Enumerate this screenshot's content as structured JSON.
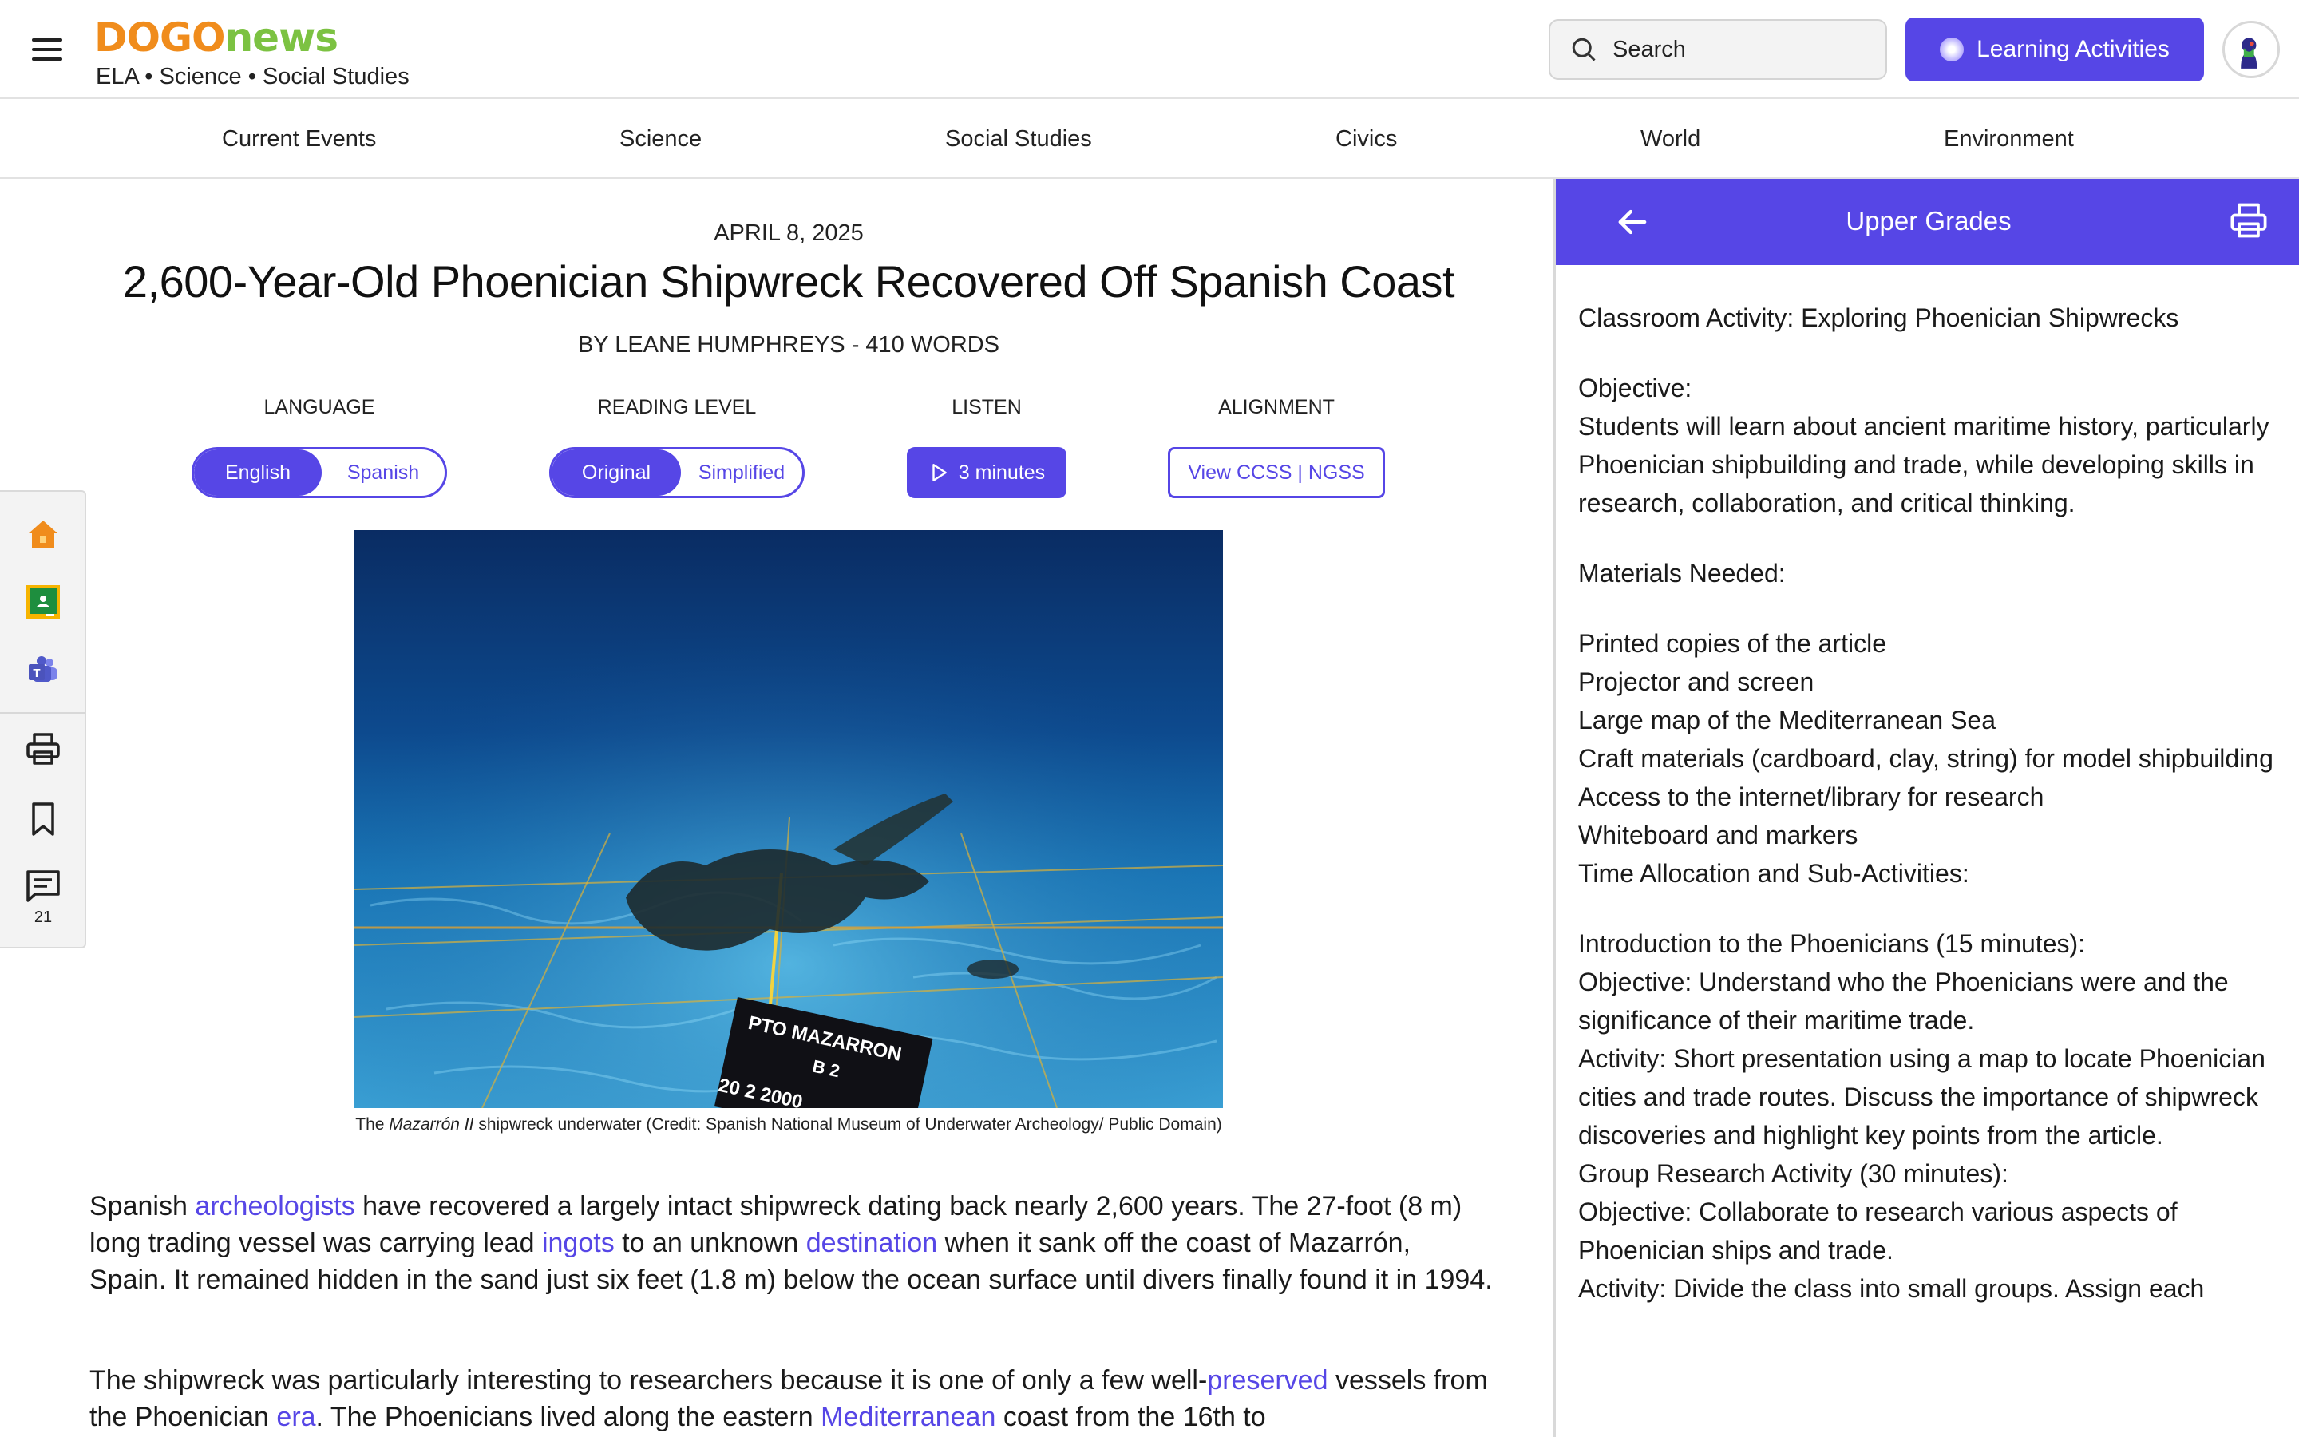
{
  "header": {
    "logo_part1": "DOGO",
    "logo_part2": "news",
    "tagline": "ELA • Science • Social Studies",
    "search_placeholder": "Search",
    "learning_activities_label": "Learning Activities",
    "brand_purple": "#5646e6",
    "logo_orange": "#f08c1c",
    "logo_green": "#7cc242"
  },
  "nav": {
    "items": [
      "Current Events",
      "Science",
      "Social Studies",
      "Civics",
      "World",
      "Environment"
    ]
  },
  "article": {
    "date": "APRIL 8, 2025",
    "title": "2,600-Year-Old Phoenician Shipwreck Recovered Off Spanish Coast",
    "byline": "BY LEANE HUMPHREYS - 410 WORDS",
    "controls": {
      "language_label": "LANGUAGE",
      "language_options": [
        "English",
        "Spanish"
      ],
      "language_selected": "English",
      "reading_label": "READING LEVEL",
      "reading_options": [
        "Original",
        "Simplified"
      ],
      "reading_selected": "Original",
      "listen_label": "LISTEN",
      "listen_button": "3 minutes",
      "alignment_label": "ALIGNMENT",
      "alignment_button": "View CCSS | NGSS"
    },
    "image": {
      "sign_line1": "PTO MAZARRON",
      "sign_line2": "B 2",
      "sign_line3": "20 2 2000"
    },
    "caption_prefix": "The ",
    "caption_ship": "Mazarrón II",
    "caption_rest": " shipwreck underwater (Credit: Spanish National Museum of Underwater Archeology/ Public Domain)",
    "p1": {
      "t1": "Spanish ",
      "l1": "archeologists",
      "t2": " have recovered a largely intact shipwreck dating back nearly 2,600 years. The 27-foot (8 m) long trading vessel was carrying lead ",
      "l2": "ingots",
      "t3": " to an unknown ",
      "l3": "destination",
      "t4": " when it sank off the coast of Mazarrón, Spain. It remained hidden in the sand just six feet (1.8 m) below the ocean surface until divers finally found it in 1994."
    },
    "p2": {
      "t1": "The shipwreck was particularly interesting to researchers because it is one of only a few well-",
      "l1": "preserved",
      "t2": " vessels from the Phoenician ",
      "l2": "era",
      "t3": ". The Phoenicians lived along the eastern ",
      "l3": "Mediterranean",
      "t4": " coast from the 16th to"
    }
  },
  "sidetools": {
    "comment_count": "21",
    "icons": [
      "home-icon",
      "google-classroom-icon",
      "microsoft-teams-icon",
      "print-icon",
      "bookmark-icon",
      "comment-icon"
    ]
  },
  "panel": {
    "title": "Upper Grades",
    "lines": [
      "Classroom Activity: Exploring Phoenician Shipwrecks",
      "",
      "Objective:",
      "Students will learn about ancient maritime history, particularly Phoenician shipbuilding and trade, while developing skills in research, collaboration, and critical thinking.",
      "",
      "Materials Needed:",
      "",
      "Printed copies of the article",
      "Projector and screen",
      "Large map of the Mediterranean Sea",
      "Craft materials (cardboard, clay, string) for model shipbuilding",
      "Access to the internet/library for research",
      "Whiteboard and markers",
      "Time Allocation and Sub-Activities:",
      "",
      "Introduction to the Phoenicians (15 minutes):",
      "Objective: Understand who the Phoenicians were and the significance of their maritime trade.",
      "Activity: Short presentation using a map to locate Phoenician cities and trade routes. Discuss the importance of shipwreck discoveries and highlight key points from the article.",
      "Group Research Activity (30 minutes):",
      "Objective: Collaborate to research various aspects of Phoenician ships and trade.",
      "Activity: Divide the class into small groups. Assign each"
    ]
  }
}
